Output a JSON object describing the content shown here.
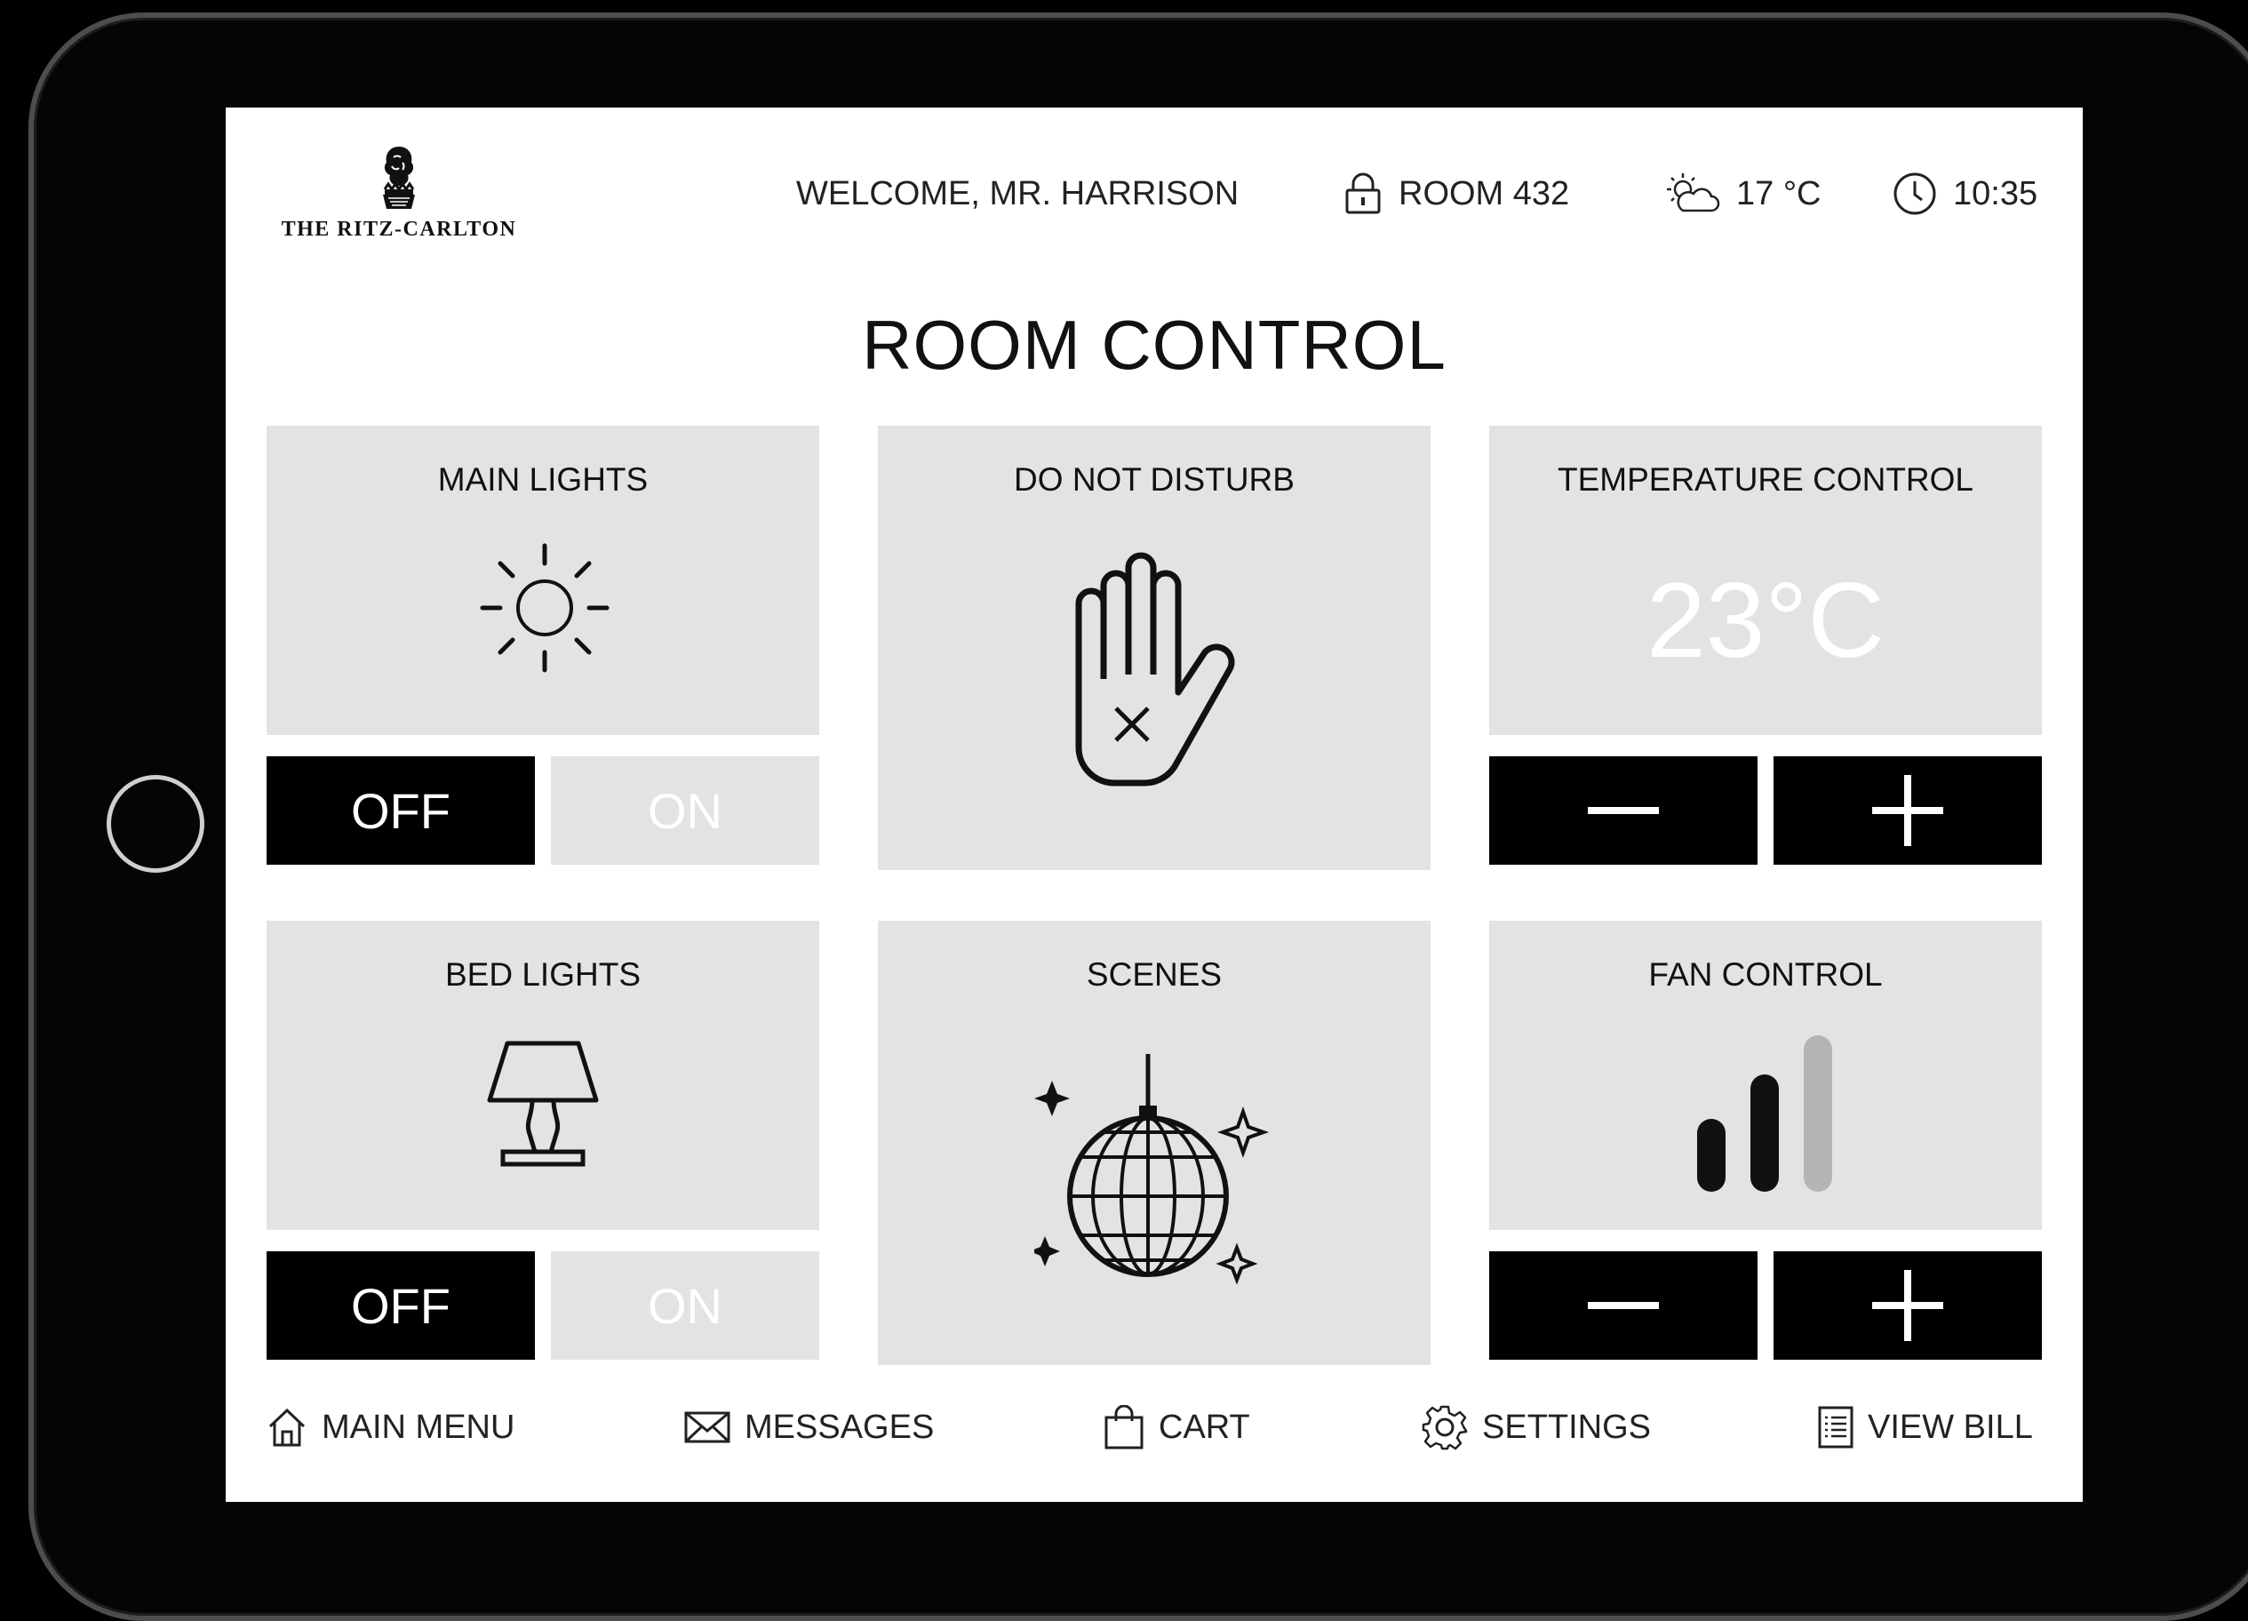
{
  "brand": {
    "name": "THE RITZ-CARLTON"
  },
  "header": {
    "welcome": "WELCOME, MR. HARRISON",
    "room": "ROOM 432",
    "weather": "17 °C",
    "time": "10:35"
  },
  "page": {
    "title": "ROOM CONTROL"
  },
  "tiles": {
    "main_lights": {
      "label": "MAIN LIGHTS",
      "off_label": "OFF",
      "on_label": "ON",
      "state": "off"
    },
    "do_not_disturb": {
      "label": "DO NOT DISTURB"
    },
    "temperature": {
      "label": "TEMPERATURE CONTROL",
      "value": "23°C"
    },
    "bed_lights": {
      "label": "BED LIGHTS",
      "off_label": "OFF",
      "on_label": "ON",
      "state": "off"
    },
    "scenes": {
      "label": "SCENES"
    },
    "fan": {
      "label": "FAN CONTROL",
      "level": 2,
      "max_level": 3
    }
  },
  "nav": {
    "main_menu": "MAIN MENU",
    "messages": "MESSAGES",
    "cart": "CART",
    "settings": "SETTINGS",
    "view_bill": "VIEW BILL"
  },
  "colors": {
    "tile_bg": "#e3e3e3",
    "active_button": "#000000",
    "inactive_button": "#e3e3e3",
    "fan_bar_active": "#111111",
    "fan_bar_inactive": "#b5b5b5"
  }
}
